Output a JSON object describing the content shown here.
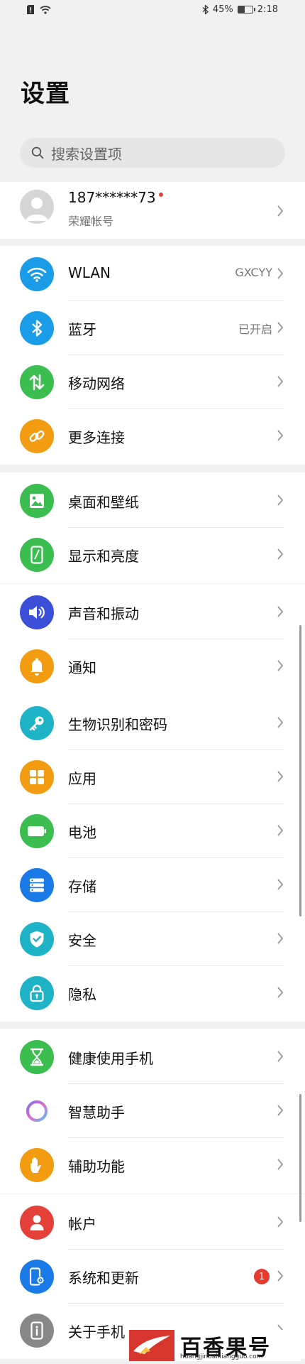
{
  "status_bar": {
    "battery": "45%",
    "time": "2:18",
    "battery_level": 0.45
  },
  "page_title": "设置",
  "search": {
    "placeholder": "搜索设置项"
  },
  "account": {
    "name": "187******73",
    "subtitle": "荣耀帐号"
  },
  "groups": [
    [
      {
        "name": "wlan",
        "label": "WLAN",
        "value": "GXCYY",
        "icon": "wifi-icon",
        "color": "#1a9ce8"
      },
      {
        "name": "bluetooth",
        "label": "蓝牙",
        "value": "已开启",
        "icon": "bluetooth-icon",
        "color": "#1a9ce8"
      },
      {
        "name": "mobile-network",
        "label": "移动网络",
        "value": "",
        "icon": "mobile-data-icon",
        "color": "#3bbd4f"
      },
      {
        "name": "more-connections",
        "label": "更多连接",
        "value": "",
        "icon": "link-icon",
        "color": "#f39c12"
      }
    ],
    [
      {
        "name": "home-wallpaper",
        "label": "桌面和壁纸",
        "value": "",
        "icon": "picture-icon",
        "color": "#3bbd4f"
      },
      {
        "name": "display-brightness",
        "label": "显示和亮度",
        "value": "",
        "icon": "phone-brightness-icon",
        "color": "#3bbd4f"
      }
    ],
    [
      {
        "name": "sound-vibration",
        "label": "声音和振动",
        "value": "",
        "icon": "speaker-icon",
        "color": "#3b4fd8"
      },
      {
        "name": "notifications",
        "label": "通知",
        "value": "",
        "icon": "bell-icon",
        "color": "#f39c12"
      }
    ],
    [
      {
        "name": "biometrics-password",
        "label": "生物识别和密码",
        "value": "",
        "icon": "key-icon",
        "color": "#1eb3c6"
      },
      {
        "name": "apps",
        "label": "应用",
        "value": "",
        "icon": "apps-grid-icon",
        "color": "#f39c12"
      },
      {
        "name": "battery",
        "label": "电池",
        "value": "",
        "icon": "battery-icon",
        "color": "#3bbd4f"
      },
      {
        "name": "storage",
        "label": "存储",
        "value": "",
        "icon": "storage-icon",
        "color": "#1a7ae8"
      },
      {
        "name": "security",
        "label": "安全",
        "value": "",
        "icon": "shield-icon",
        "color": "#1eb3c6"
      },
      {
        "name": "privacy",
        "label": "隐私",
        "value": "",
        "icon": "privacy-lock-icon",
        "color": "#1eb3c6"
      }
    ],
    [
      {
        "name": "digital-balance",
        "label": "健康使用手机",
        "value": "",
        "icon": "hourglass-icon",
        "color": "#3bbd4f"
      },
      {
        "name": "assistant",
        "label": "智慧助手",
        "value": "",
        "icon": "assistant-ring-icon",
        "color": "#ffffff"
      },
      {
        "name": "accessibility",
        "label": "辅助功能",
        "value": "",
        "icon": "hand-icon",
        "color": "#f39c12"
      }
    ],
    [
      {
        "name": "accounts",
        "label": "帐户",
        "value": "",
        "icon": "user-icon",
        "color": "#e5413a"
      },
      {
        "name": "system-update",
        "label": "系统和更新",
        "value": "",
        "icon": "phone-gear-icon",
        "color": "#1a7ae8",
        "badge": "1"
      },
      {
        "name": "about-phone",
        "label": "关于手机",
        "value": "",
        "icon": "phone-info-icon",
        "color": "#888888"
      }
    ]
  ],
  "watermark": {
    "brand": "百香果号",
    "url": "huangjinbaixiangguo.com"
  }
}
